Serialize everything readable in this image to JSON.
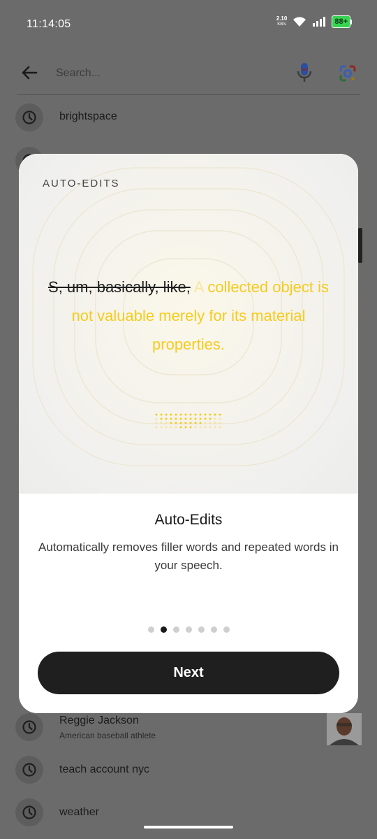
{
  "status_bar": {
    "time": "11:14:05",
    "net_speed_value": "2.10",
    "net_speed_unit": "KB/s",
    "battery": "88+"
  },
  "search": {
    "placeholder": "Search..."
  },
  "history": [
    {
      "label": "brightspace",
      "sublabel": ""
    },
    {
      "label": "Reggie Jackson",
      "sublabel": "American baseball athlete"
    },
    {
      "label": "teach account nyc",
      "sublabel": ""
    },
    {
      "label": "weather",
      "sublabel": ""
    }
  ],
  "modal": {
    "eyebrow": "AUTO-EDITS",
    "demo": {
      "filler": "S, um, basically, like,",
      "fade_word": "A",
      "kept": "collected object is not valuable merely for its material properties."
    },
    "title": "Auto-Edits",
    "description": "Automatically removes filler words and repeated words in your speech.",
    "pager": {
      "count": 7,
      "active_index": 1
    },
    "next_label": "Next"
  },
  "colors": {
    "accent_yellow": "#f5cc1c",
    "button_dark": "#1f1f1f",
    "scrim": "#6b6b6b"
  },
  "icons": {
    "back": "arrow-left-icon",
    "mic": "mic-icon",
    "lens": "lens-icon",
    "history": "clock-icon",
    "wifi": "wifi-icon",
    "signal": "signal-icon",
    "battery": "battery-icon"
  }
}
